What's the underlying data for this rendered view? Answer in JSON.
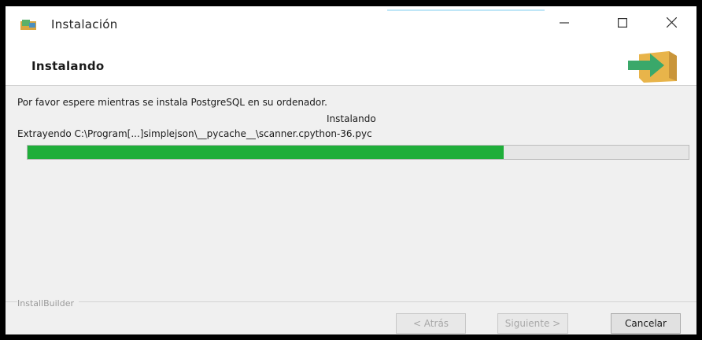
{
  "window": {
    "title": "Instalación",
    "controls": [
      "minimize-icon",
      "maximize-icon",
      "close-icon"
    ]
  },
  "header": {
    "title": "Instalando",
    "icon": "installer-box-arrow-icon"
  },
  "content": {
    "message": "Por favor espere mientras se instala PostgreSQL en su ordenador.",
    "status": "Instalando",
    "extracting": "Extrayendo C:\\Program[...]simplejson\\__pycache__\\scanner.cpython-36.pyc",
    "progress_fraction": 0.72
  },
  "footer": {
    "brand": "InstallBuilder",
    "back_label": "< Atrás",
    "next_label": "Siguiente >",
    "cancel_label": "Cancelar"
  },
  "colors": {
    "progress": "#1fae3a",
    "header_arrow": "#3aa86a",
    "header_box": "#e8b44a"
  }
}
